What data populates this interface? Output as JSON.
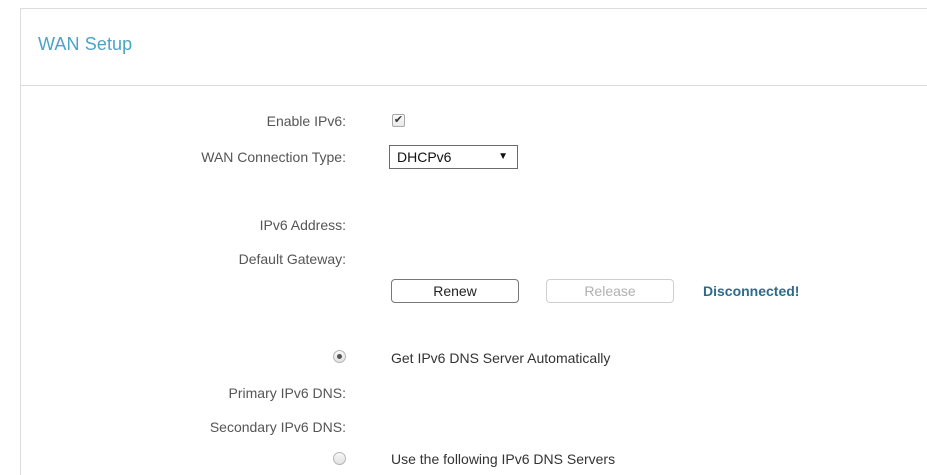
{
  "section": {
    "title": "WAN Setup"
  },
  "form": {
    "enable_ipv6_label": "Enable IPv6:",
    "enable_ipv6_checked": true,
    "connection_type_label": "WAN Connection Type:",
    "connection_type_value": "DHCPv6",
    "ipv6_address_label": "IPv6 Address:",
    "default_gateway_label": "Default Gateway:",
    "renew_label": "Renew",
    "release_label": "Release",
    "status_text": "Disconnected!",
    "dns_auto_label": "Get IPv6 DNS Server Automatically",
    "dns_auto_selected": true,
    "primary_dns_label": "Primary IPv6 DNS:",
    "secondary_dns_label": "Secondary IPv6 DNS:",
    "dns_manual_label": "Use the following IPv6 DNS Servers",
    "dns_manual_selected": false
  },
  "colors": {
    "title": "#4aa3c9",
    "status": "#2d6b8a",
    "label": "#555555"
  },
  "icons": {
    "checkbox_mark": "✔",
    "dropdown_arrow": "▼"
  }
}
